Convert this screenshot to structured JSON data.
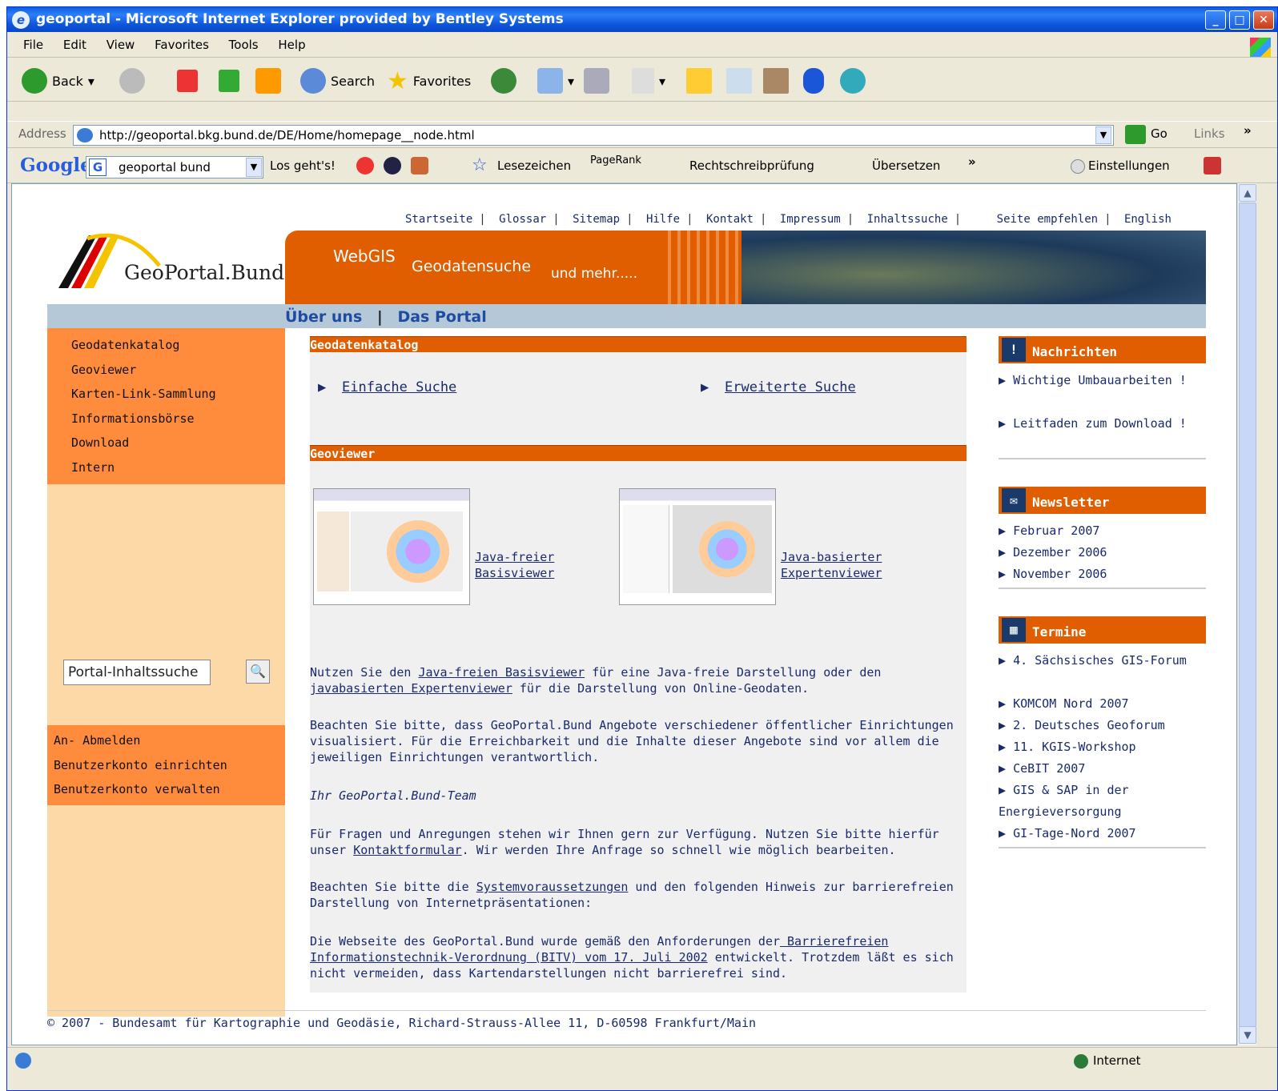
{
  "window": {
    "title": "geoportal - Microsoft Internet Explorer provided by Bentley Systems"
  },
  "menu": [
    "File",
    "Edit",
    "View",
    "Favorites",
    "Tools",
    "Help"
  ],
  "toolbar": {
    "back": "Back",
    "search": "Search",
    "favorites": "Favorites"
  },
  "address": {
    "label": "Address",
    "url": "http://geoportal.bkg.bund.de/DE/Home/homepage__node.html",
    "go": "Go",
    "links": "Links"
  },
  "google": {
    "query": "geoportal bund",
    "go": "Los geht's!",
    "bookmarks": "Lesezeichen",
    "pagerank": "PageRank",
    "spell": "Rechtschreibprüfung",
    "translate": "Übersetzen",
    "settings": "Einstellungen"
  },
  "page": {
    "topnav": [
      "Startseite",
      "Glossar",
      "Sitemap",
      "Hilfe",
      "Kontakt",
      "Impressum",
      "Inhaltssuche",
      "Seite empfehlen",
      "English"
    ],
    "logo": "GeoPortal.Bund",
    "banner": {
      "webgis": "WebGIS",
      "geodaten": "Geodatensuche",
      "mehr": "und mehr....."
    },
    "subnav": {
      "about": "Über uns",
      "portal": "Das Portal"
    },
    "leftmenu": [
      "Geodatenkatalog",
      "Geoviewer",
      "Karten-Link-Sammlung",
      "Informationsbörse",
      "Download",
      "Intern"
    ],
    "search_placeholder": "Portal-Inhaltssuche",
    "account": [
      "An- Abmelden",
      "Benutzerkonto einrichten",
      "Benutzerkonto verwalten"
    ],
    "catalog": {
      "title": "Geodatenkatalog",
      "simple": "Einfache Suche",
      "advanced": "Erweiterte Suche"
    },
    "viewer": {
      "title": "Geoviewer",
      "basis1": "Java-freier",
      "basis2": "Basisviewer",
      "expert1": "Java-basierter",
      "expert2": "Expertenviewer"
    },
    "p1a": "Nutzen Sie den ",
    "p1link1": "Java-freien Basisviewer",
    "p1b": " für eine Java-freie Darstellung oder den",
    "p1link2": "javabasierten Expertenviewer",
    "p1c": " für die Darstellung von Online-Geodaten.",
    "p2": "Beachten Sie bitte, dass GeoPortal.Bund Angebote verschiedener öffentlicher Einrichtungen visualisiert. Für die Erreichbarkeit und die Inhalte dieser Angebote sind vor allem die jeweiligen Einrichtungen verantwortlich.",
    "p3": "Ihr GeoPortal.Bund-Team",
    "p4a": "Für Fragen und Anregungen stehen wir Ihnen gern zur Verfügung. Nutzen Sie bitte hierfür unser ",
    "p4link": "Kontaktformular",
    "p4b": ". Wir werden Ihre Anfrage so schnell wie möglich bearbeiten.",
    "p5a": "Beachten Sie bitte die ",
    "p5link": "Systemvoraussetzungen",
    "p5b": " und den folgenden Hinweis zur barrierefreien Darstellung von Internetpräsentationen:",
    "p6a": "Die Webseite des GeoPortal.Bund wurde gemäß den Anforderungen der",
    "p6link": " Barrierefreien Informationstechnik-Verordnung (BITV) vom 17. Juli 2002",
    "p6b": " entwickelt. Trotzdem läßt es sich nicht vermeiden, dass Kartendarstellungen nicht barrierefrei sind.",
    "news": {
      "title": "Nachrichten",
      "items": [
        "Wichtige Umbauarbeiten !",
        "Leitfaden zum Download !"
      ]
    },
    "newsletter": {
      "title": "Newsletter",
      "items": [
        "Februar 2007",
        "Dezember 2006",
        "November 2006"
      ]
    },
    "termine": {
      "title": "Termine",
      "items": [
        "4. Sächsisches GIS-Forum",
        "KOMCOM Nord 2007",
        "2. Deutsches Geoforum",
        "11. KGIS-Workshop",
        "CeBIT 2007",
        "GIS & SAP in der",
        "Energieversorgung",
        "GI-Tage-Nord 2007"
      ]
    },
    "footer": "© 2007 - Bundesamt für Kartographie und Geodäsie, Richard-Strauss-Allee 11, D-60598 Frankfurt/Main"
  },
  "status": {
    "zone": "Internet"
  }
}
